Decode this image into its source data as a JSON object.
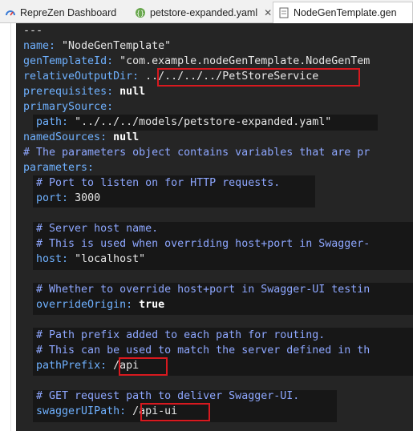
{
  "tabs": [
    {
      "label": "RepreZen Dashboard",
      "icon": "dashboard-icon",
      "closable": false
    },
    {
      "label": "petstore-expanded.yaml",
      "icon": "swagger-file-icon",
      "closable": true
    },
    {
      "label": "NodeGenTemplate.gen",
      "icon": "gentemplate-file-icon",
      "closable": false
    }
  ],
  "close_glyph": "✕",
  "colors": {
    "editor_bg": "#252525",
    "key": "#6fb1ff",
    "comment": "#8ea7ff",
    "highlight_box": "#d8191f"
  },
  "code": {
    "doc_start": "---",
    "name_key": "name:",
    "name_val": "\"NodeGenTemplate\"",
    "gtid_key": "genTemplateId:",
    "gtid_val": "\"com.example.nodeGenTemplate.NodeGenTem",
    "rod_key": "relativeOutputDir:",
    "rod_val": "../../../../PetStoreService",
    "prereq_key": "prerequisites:",
    "prereq_val": "null",
    "primary_key": "primarySource:",
    "path_key": "path:",
    "path_val": "\"../../../models/petstore-expanded.yaml\"",
    "named_key": "namedSources:",
    "named_val": "null",
    "params_comment": "# The parameters object contains variables that are pr",
    "params_key": "parameters:",
    "port_comment": "# Port to listen on for HTTP requests.",
    "port_key": "port:",
    "port_val": "3000",
    "host_comment1": "# Server host name.",
    "host_comment2": "# This is used when overriding host+port in Swagger-",
    "host_key": "host:",
    "host_val": "\"localhost\"",
    "override_comment": "# Whether to override host+port in Swagger-UI testin",
    "override_key": "overrideOrigin:",
    "override_val": "true",
    "prefix_comment1": "# Path prefix added to each path for routing.",
    "prefix_comment2": "# This can be used to match the server defined in th",
    "prefix_key": "pathPrefix:",
    "prefix_val": "/api",
    "ui_comment": "# GET request path to deliver Swagger-UI.",
    "ui_key": "swaggerUIPath:",
    "ui_val": "/api-ui"
  }
}
